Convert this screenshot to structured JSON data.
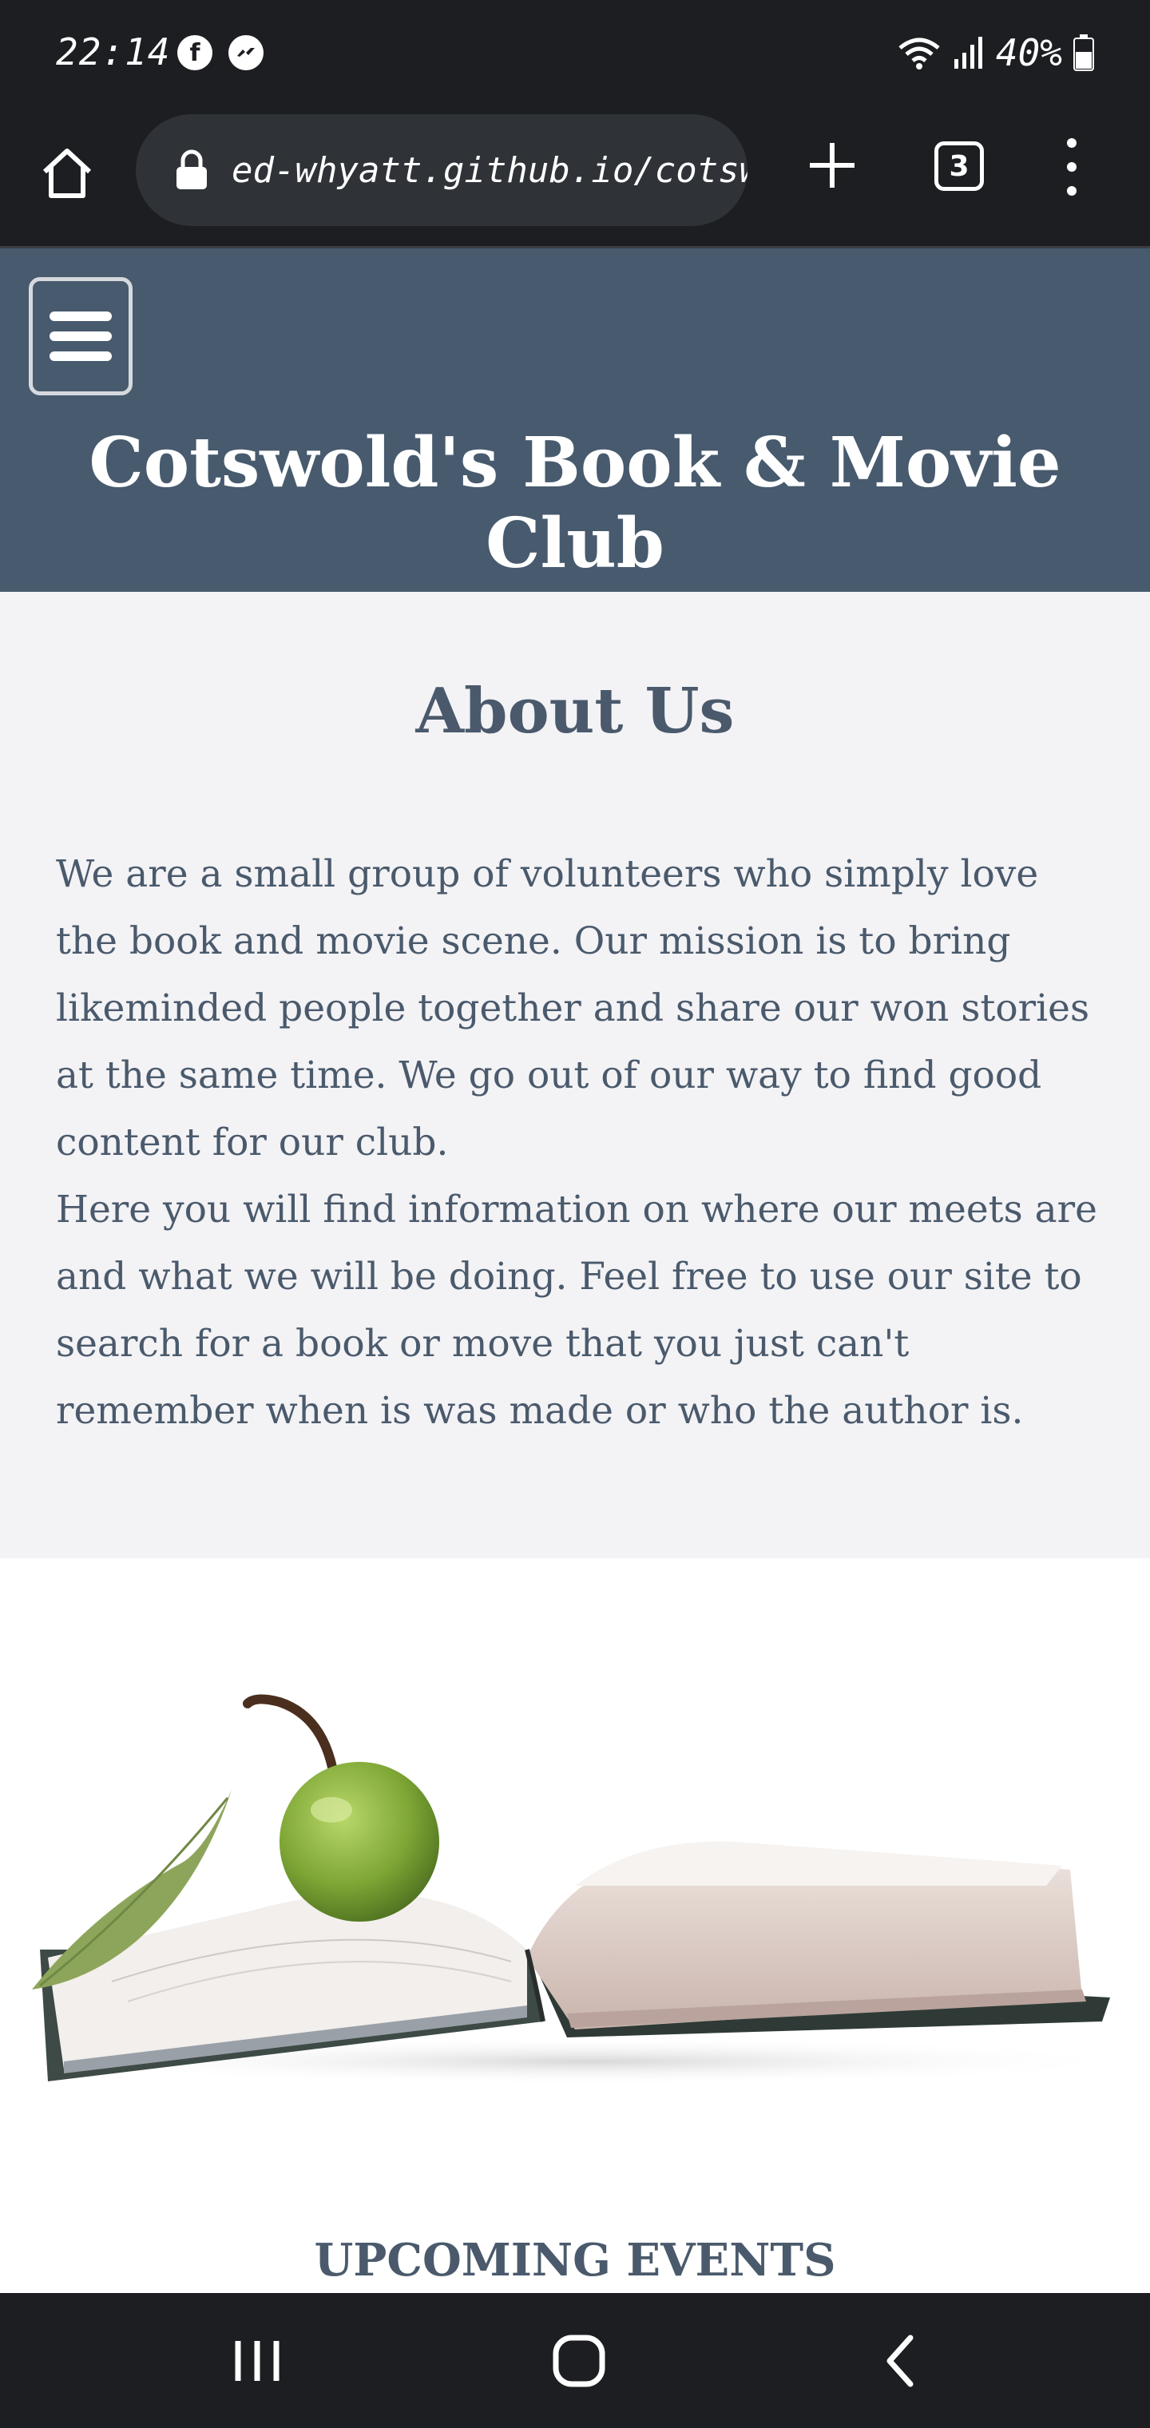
{
  "status_bar": {
    "time": "22:14",
    "battery": "40%",
    "app_icons": [
      "facebook-icon",
      "messenger-icon"
    ],
    "indicator_icons": [
      "wifi-icon",
      "signal-icon",
      "battery-icon"
    ]
  },
  "browser": {
    "url": "ed-whyatt.github.io/cotswo",
    "tab_count": "3"
  },
  "header": {
    "title": "Cotswold's Book & Movie Club",
    "background": "#475a6e"
  },
  "about": {
    "heading": "About Us",
    "paragraphs": [
      "We are a small group of volunteers who simply love the book and movie scene. Our mission is to bring likeminded people together and share our won stories at the same time. We go out of our way to find good content for our club.",
      "Here you will find information on where our meets are and what we will be doing. Feel free to use our site to search for a book or move that you just can't remember when is was made or who the author is."
    ]
  },
  "events": {
    "heading": "UPCOMING EVENTS"
  },
  "colors": {
    "text": "#4a5a6c",
    "about_bg": "#f3f2f5",
    "system_bar": "#1c1e21"
  }
}
